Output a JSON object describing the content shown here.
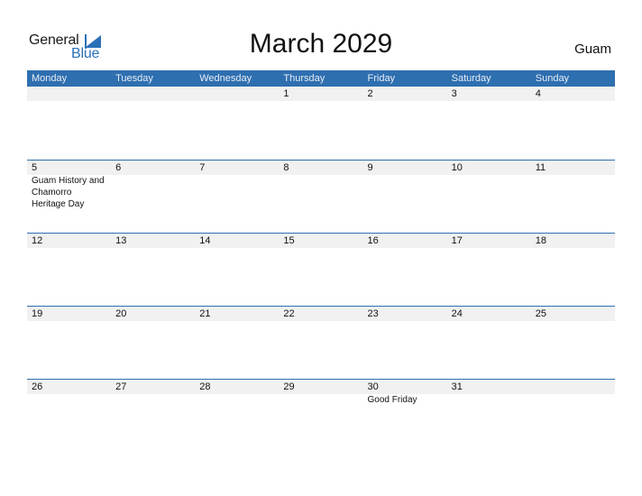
{
  "logo": {
    "word1": "General",
    "word2": "Blue"
  },
  "header": {
    "title": "March 2029",
    "region": "Guam"
  },
  "colors": {
    "accent": "#2e6fb0",
    "row_bg": "#f1f1f1"
  },
  "weekdays": [
    "Monday",
    "Tuesday",
    "Wednesday",
    "Thursday",
    "Friday",
    "Saturday",
    "Sunday"
  ],
  "weeks": [
    {
      "days": [
        "",
        "",
        "",
        "1",
        "2",
        "3",
        "4"
      ],
      "events": [
        "",
        "",
        "",
        "",
        "",
        "",
        ""
      ]
    },
    {
      "days": [
        "5",
        "6",
        "7",
        "8",
        "9",
        "10",
        "11"
      ],
      "events": [
        "Guam History and Chamorro Heritage Day",
        "",
        "",
        "",
        "",
        "",
        ""
      ]
    },
    {
      "days": [
        "12",
        "13",
        "14",
        "15",
        "16",
        "17",
        "18"
      ],
      "events": [
        "",
        "",
        "",
        "",
        "",
        "",
        ""
      ]
    },
    {
      "days": [
        "19",
        "20",
        "21",
        "22",
        "23",
        "24",
        "25"
      ],
      "events": [
        "",
        "",
        "",
        "",
        "",
        "",
        ""
      ]
    },
    {
      "days": [
        "26",
        "27",
        "28",
        "29",
        "30",
        "31",
        ""
      ],
      "events": [
        "",
        "",
        "",
        "",
        "Good Friday",
        "",
        ""
      ]
    }
  ]
}
